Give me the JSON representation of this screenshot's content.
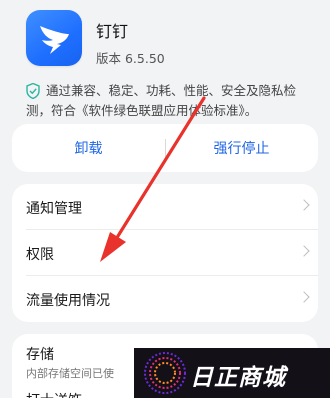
{
  "app": {
    "name": "钉钉",
    "version": "版本 6.5.50",
    "icon": "dingtalk-app-icon"
  },
  "security_note": {
    "line1": "通过兼容、稳定、功耗、性能、安全及隐私检",
    "line2": "测，符合《软件绿色联盟应用体验标准》。",
    "icon": "shield-check-icon",
    "icon_color": "#2bb5a0"
  },
  "actions": {
    "uninstall": "卸载",
    "force_stop": "强行停止",
    "accent_color": "#1f66e6"
  },
  "settings": [
    {
      "label": "通知管理"
    },
    {
      "label": "权限"
    },
    {
      "label": "流量使用情况"
    }
  ],
  "storage": {
    "title": "存储",
    "subtitle": "内部存储空间已使",
    "next_item_partial": "打士送饰"
  },
  "annotation": {
    "type": "red-arrow",
    "color": "#e8322b",
    "points_to": "权限"
  },
  "watermark": {
    "text": "日正商城"
  }
}
